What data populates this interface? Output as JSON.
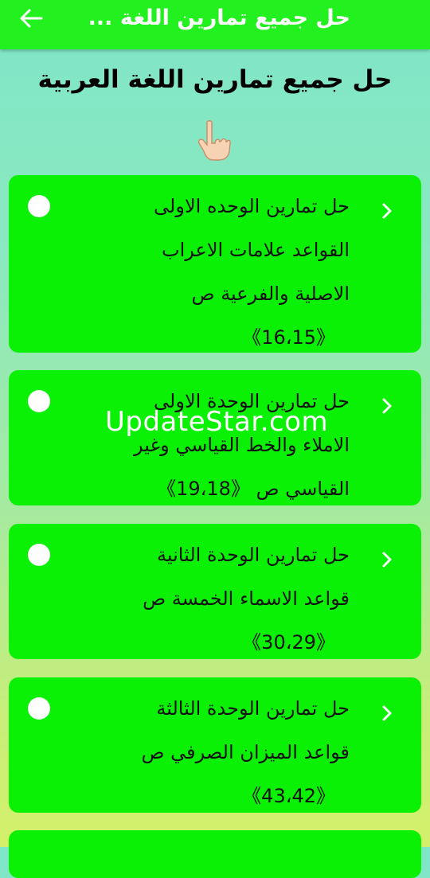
{
  "appbar": {
    "title": "حل جميع تمارين اللغة ...",
    "back_icon": "arrow-back-icon"
  },
  "heading": "حل جميع تمارين اللغة العربية",
  "pointer_icon": "pointing-down-hand-icon",
  "colors": {
    "appbar": "#22f11f",
    "card": "#0bf106",
    "dot": "#ffffff"
  },
  "cards": [
    {
      "lines": [
        "حل تمارين الوحده الاولى",
        "القواعد علامات الاعراب",
        "الاصلية والفرعية ص",
        "《16،15》"
      ]
    },
    {
      "lines": [
        "حل تمارين الوحدة الاولى",
        "الاملاء والخط القياسي وغير",
        "القياسي ص 《19،18》"
      ]
    },
    {
      "lines": [
        "حل تمارين الوحدة الثانية",
        "قواعد الاسماء الخمسة ص",
        "《30،29》"
      ]
    },
    {
      "lines": [
        "حل تمارين الوحدة الثالثة",
        "قواعد الميزان الصرفي ص",
        "《43،42》"
      ]
    }
  ],
  "watermark": "UpdateStar.com"
}
